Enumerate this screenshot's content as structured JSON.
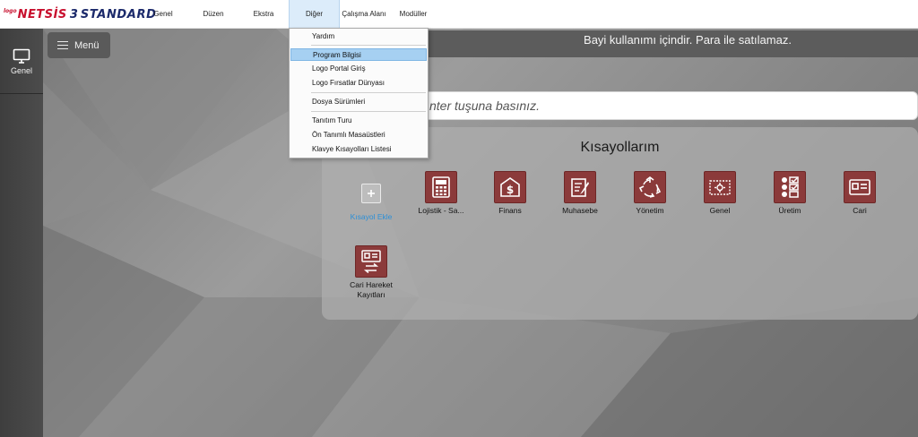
{
  "app": {
    "logo_prefix": "logo",
    "logo_main": "NETSİS",
    "logo_num": "3",
    "logo_edition": "STANDARD"
  },
  "menubar": {
    "items": [
      {
        "label": "Genel"
      },
      {
        "label": "Düzen"
      },
      {
        "label": "Ekstra"
      },
      {
        "label": "Diğer"
      },
      {
        "label": "Çalışma Alanı"
      },
      {
        "label": "Modüller"
      }
    ],
    "active": "Diğer"
  },
  "dropdown": {
    "items": [
      {
        "label": "Yardım"
      },
      {
        "label": "Program Bilgisi"
      },
      {
        "label": "Logo Portal Giriş"
      },
      {
        "label": "Logo Fırsatlar Dünyası"
      },
      {
        "label": "Dosya Sürümleri"
      },
      {
        "label": "Tanıtım Turu"
      },
      {
        "label": "Ön Tanımlı Masaüstleri"
      },
      {
        "label": "Klavye Kısayolları Listesi"
      }
    ],
    "highlighted": "Program Bilgisi"
  },
  "sidebar": {
    "items": [
      {
        "label": "Genel",
        "icon": "monitor-icon"
      }
    ]
  },
  "menu_button": {
    "label": "Menü",
    "icon": "hamburger-icon"
  },
  "banner": {
    "text": "Bayi kullanımı içindir. Para ile satılamaz."
  },
  "search": {
    "text": "nter tuşuna basınız."
  },
  "shortcuts": {
    "title": "Kısayollarım",
    "add_label": "Kısayol Ekle",
    "items": [
      {
        "label": "Lojistik - Sa...",
        "icon": "calculator-icon"
      },
      {
        "label": "Finans",
        "icon": "bank-dollar-icon"
      },
      {
        "label": "Muhasebe",
        "icon": "ledger-icon"
      },
      {
        "label": "Yönetim",
        "icon": "recycle-icon"
      },
      {
        "label": "Genel",
        "icon": "settings-card-icon"
      },
      {
        "label": "Üretim",
        "icon": "checklist-icon"
      },
      {
        "label": "Cari",
        "icon": "id-card-icon"
      },
      {
        "label": "Cari Hareket Kayıtları",
        "icon": "card-transfer-icon"
      }
    ]
  },
  "colors": {
    "shortcut_tile": "#8b3a3a",
    "menu_active": "#dcecfa",
    "dropdown_highlight": "#a6d0f2",
    "sidebar": "#444444",
    "add_label": "#2d8fd6"
  }
}
